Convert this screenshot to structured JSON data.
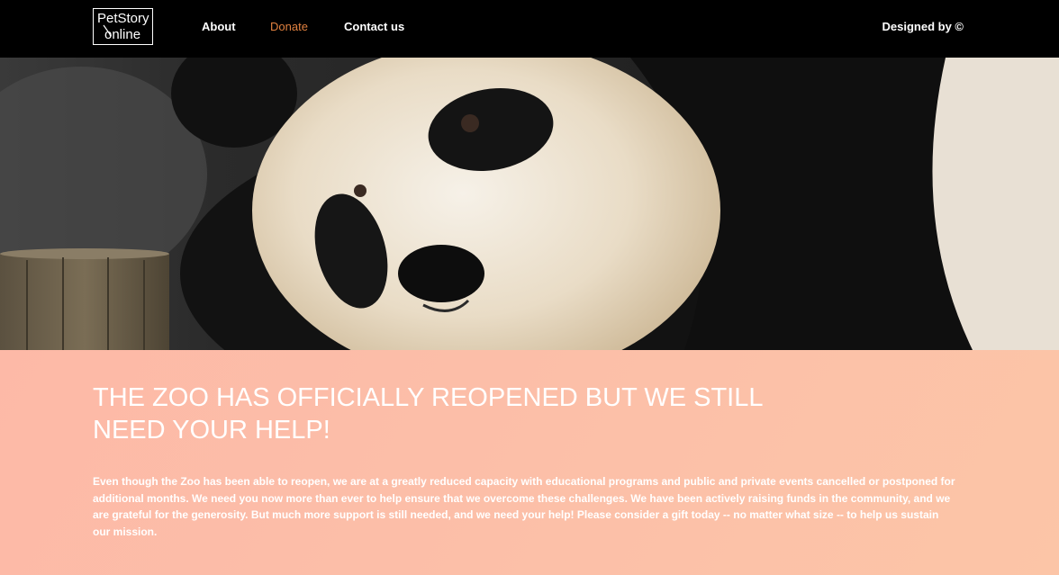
{
  "navbar": {
    "logo_line1": "PetStory",
    "logo_line2": "online",
    "links": [
      {
        "label": "About"
      },
      {
        "label": "Donate"
      },
      {
        "label": "Contact us"
      }
    ],
    "designed_by": "Designed by ©"
  },
  "colors": {
    "navbar_bg": "#000000",
    "active_link": "#e0803f",
    "content_bg": "#fcbfa8",
    "text": "#ffffff"
  },
  "hero": {
    "image_icon": "panda-photo"
  },
  "main": {
    "headline": "THE ZOO HAS OFFICIALLY REOPENED BUT WE STILL NEED YOUR HELP!",
    "body": "Even though the Zoo has been able to reopen, we are at a greatly reduced capacity with educational programs and public and private events cancelled or postponed for additional months. We need you now more than ever to help ensure that we overcome these challenges. We have been actively raising funds in the community, and we are grateful for the generosity.  But much more support is still needed, and we need your help! Please consider a gift today -- no matter what size -- to help us sustain our mission."
  }
}
